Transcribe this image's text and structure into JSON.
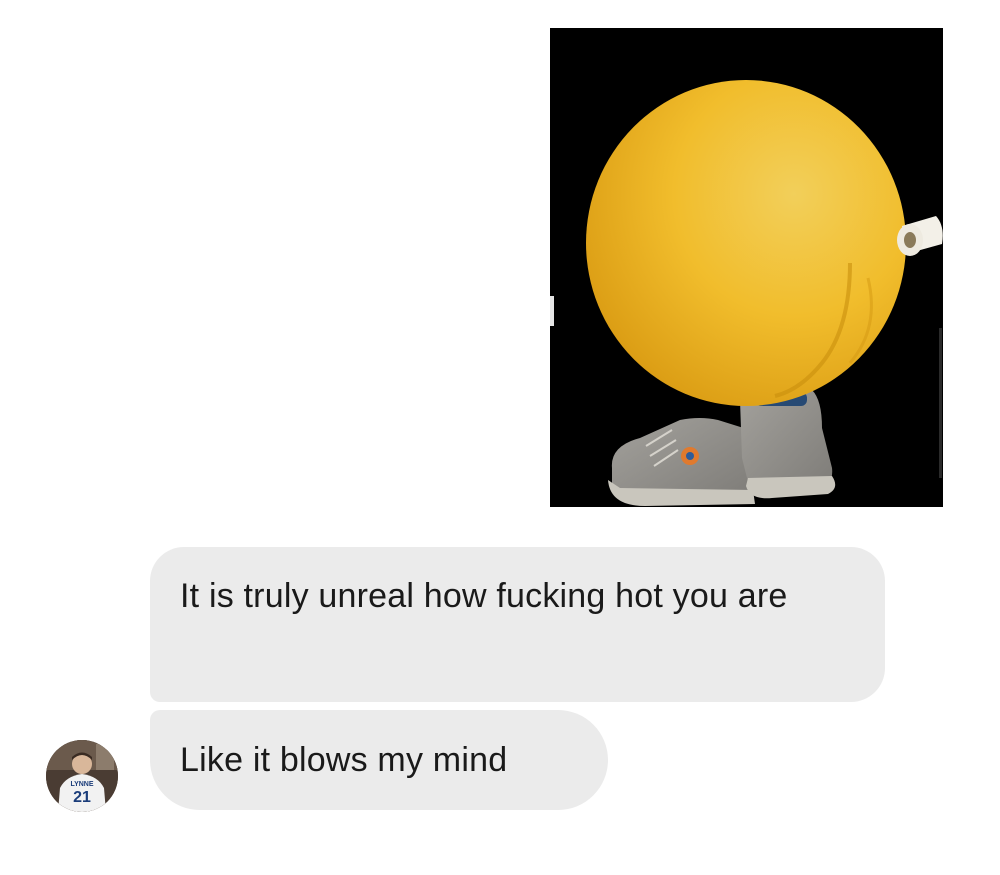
{
  "conversation": {
    "messages": [
      {
        "type": "image",
        "from": "me",
        "description_icon": "photo-attachment"
      },
      {
        "type": "text",
        "from": "them",
        "text": "It is truly unreal how fucking hot you are"
      },
      {
        "type": "text",
        "from": "them",
        "text": "Like it blows my mind"
      }
    ],
    "avatar": {
      "jersey_number": "21",
      "jersey_name": "LYNNE"
    }
  },
  "colors": {
    "bubble_bg": "#ebebeb",
    "bubble_text": "#1a1a1a",
    "image_bg": "#000000",
    "page_bg": "#ffffff"
  }
}
